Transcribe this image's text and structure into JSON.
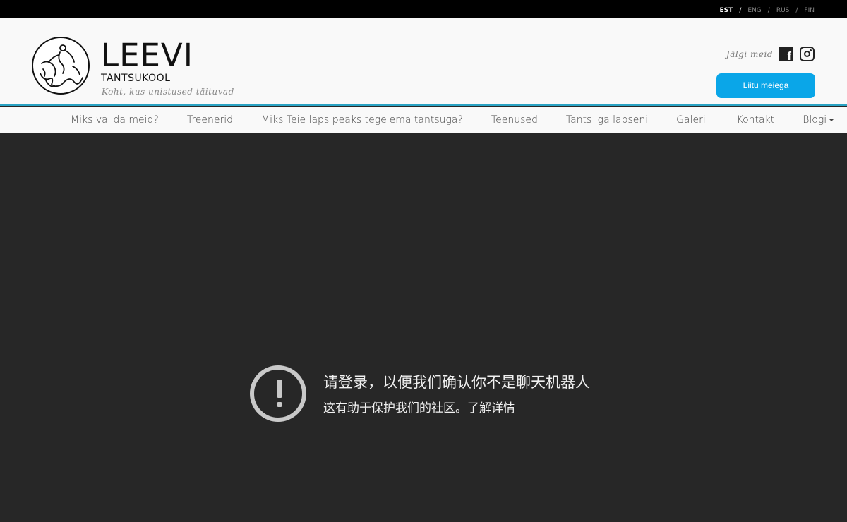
{
  "languages": [
    {
      "label": "EST",
      "active": true
    },
    {
      "label": "ENG",
      "active": false
    },
    {
      "label": "RUS",
      "active": false
    },
    {
      "label": "FIN",
      "active": false
    }
  ],
  "lang_separator": "/",
  "brand": {
    "name": "LEEVI",
    "subtitle": "TANTSUKOOL",
    "tagline": "Koht, kus unistused täituvad"
  },
  "social": {
    "follow_label": "Jälgi meid",
    "icons": [
      "facebook-icon",
      "instagram-icon"
    ]
  },
  "join_button": "Liitu meiega",
  "nav": {
    "items": [
      "Miks valida meid?",
      "Treenerid",
      "Miks Teie laps peaks tegelema tantsuga?",
      "Teenused",
      "Tants iga lapseni",
      "Galerii",
      "Kontakt",
      "Blogi"
    ]
  },
  "overlay": {
    "title": "请登录，以便我们确认你不是聊天机器人",
    "subtitle": "这有助于保护我们的社区。",
    "link": "了解详情"
  },
  "colors": {
    "topbar": "#000000",
    "header_bg": "#f9f9f9",
    "accent_line": "#2aa3c4",
    "button": "#0aa6e8",
    "content_bg": "#272727",
    "alert_icon": "#c9c9c9"
  }
}
